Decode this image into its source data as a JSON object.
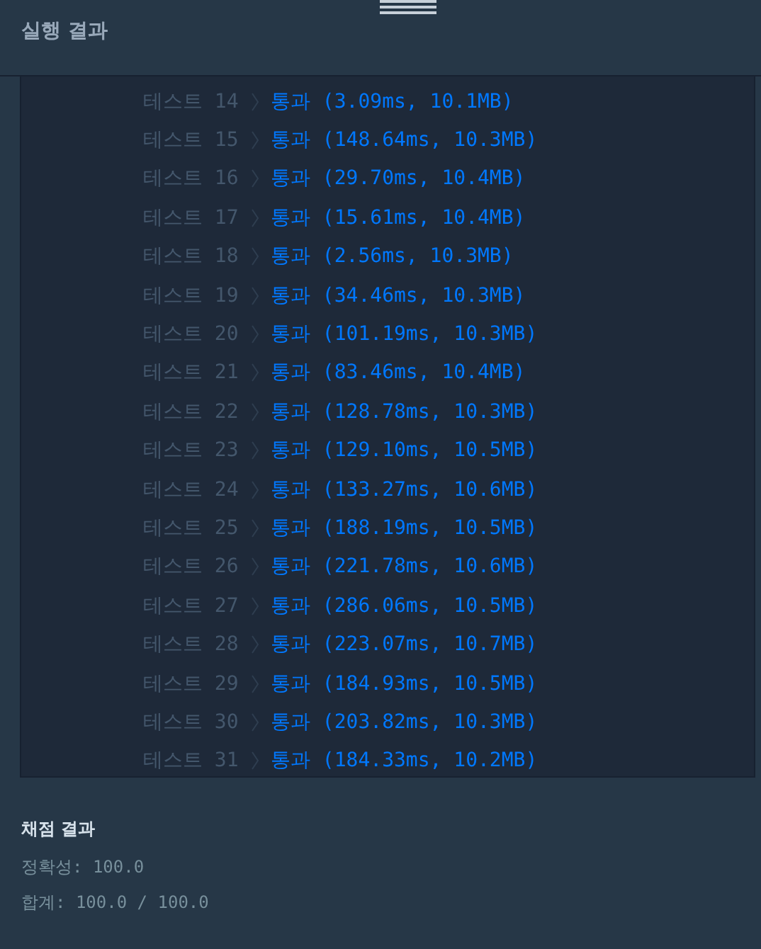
{
  "header": {
    "title": "실행 결과"
  },
  "tests": [
    {
      "label": "테스트 14",
      "result": "통과 (3.09ms, 10.1MB)"
    },
    {
      "label": "테스트 15",
      "result": "통과 (148.64ms, 10.3MB)"
    },
    {
      "label": "테스트 16",
      "result": "통과 (29.70ms, 10.4MB)"
    },
    {
      "label": "테스트 17",
      "result": "통과 (15.61ms, 10.4MB)"
    },
    {
      "label": "테스트 18",
      "result": "통과 (2.56ms, 10.3MB)"
    },
    {
      "label": "테스트 19",
      "result": "통과 (34.46ms, 10.3MB)"
    },
    {
      "label": "테스트 20",
      "result": "통과 (101.19ms, 10.3MB)"
    },
    {
      "label": "테스트 21",
      "result": "통과 (83.46ms, 10.4MB)"
    },
    {
      "label": "테스트 22",
      "result": "통과 (128.78ms, 10.3MB)"
    },
    {
      "label": "테스트 23",
      "result": "통과 (129.10ms, 10.5MB)"
    },
    {
      "label": "테스트 24",
      "result": "통과 (133.27ms, 10.6MB)"
    },
    {
      "label": "테스트 25",
      "result": "통과 (188.19ms, 10.5MB)"
    },
    {
      "label": "테스트 26",
      "result": "통과 (221.78ms, 10.6MB)"
    },
    {
      "label": "테스트 27",
      "result": "통과 (286.06ms, 10.5MB)"
    },
    {
      "label": "테스트 28",
      "result": "통과 (223.07ms, 10.7MB)"
    },
    {
      "label": "테스트 29",
      "result": "통과 (184.93ms, 10.5MB)"
    },
    {
      "label": "테스트 30",
      "result": "통과 (203.82ms, 10.3MB)"
    },
    {
      "label": "테스트 31",
      "result": "통과 (184.33ms, 10.2MB)"
    }
  ],
  "grading": {
    "title": "채점 결과",
    "accuracy": "정확성: 100.0",
    "total": "합계: 100.0 / 100.0"
  }
}
